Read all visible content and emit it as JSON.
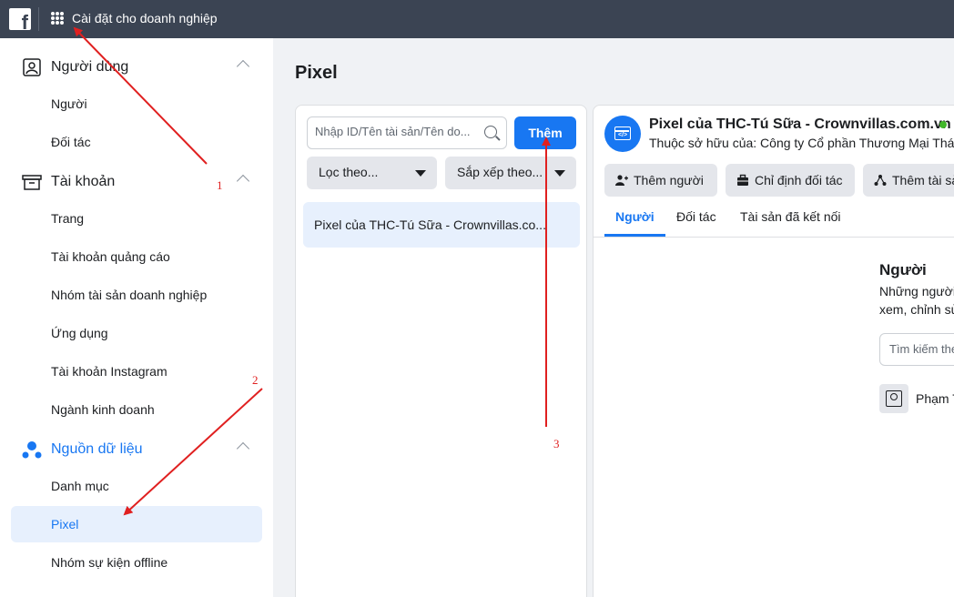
{
  "topbar": {
    "title": "Cài đặt cho doanh nghiệp",
    "logo_letter": "f"
  },
  "sidebar": {
    "sections": [
      {
        "label": "Người dùng",
        "icon": "user-card-icon",
        "items": [
          "Người",
          "Đối tác"
        ]
      },
      {
        "label": "Tài khoản",
        "icon": "archive-box-icon",
        "items": [
          "Trang",
          "Tài khoản quảng cáo",
          "Nhóm tài sản doanh nghiệp",
          "Ứng dụng",
          "Tài khoản Instagram",
          "Ngành kinh doanh"
        ]
      },
      {
        "label": "Nguồn dữ liệu",
        "icon": "data-sources-icon",
        "items": [
          "Danh mục",
          "Pixel",
          "Nhóm sự kiện offline"
        ]
      }
    ],
    "selected_item": "Pixel"
  },
  "page": {
    "title": "Pixel"
  },
  "list_panel": {
    "search_placeholder": "Nhập ID/Tên tài sản/Tên do...",
    "add_button": "Thêm",
    "filter_label": "Lọc theo...",
    "sort_label": "Sắp xếp theo...",
    "items": [
      "Pixel của THC-Tú Sữa - Crownvillas.co..."
    ]
  },
  "detail": {
    "name": "Pixel của THC-Tú Sữa - Crownvillas.com.vn",
    "owner": "Thuộc sở hữu của: Công ty Cổ phần Thương Mại Thái",
    "actions": [
      "Thêm người",
      "Chỉ định đối tác",
      "Thêm tài sả"
    ],
    "tabs": [
      "Người",
      "Đối tác",
      "Tài sản đã kết nối"
    ],
    "active_tab": "Người",
    "people_title": "Người",
    "people_desc_1": "Những người",
    "people_desc_2": "xem, chỉnh sử",
    "people_search_placeholder": "Tìm kiếm the",
    "person_name": "Phạm T"
  },
  "annotations": {
    "labels": [
      "1",
      "2",
      "3"
    ],
    "color": "#e02020"
  },
  "colors": {
    "accent": "#1877f2",
    "topbar": "#3b4453",
    "online": "#42b72a"
  }
}
